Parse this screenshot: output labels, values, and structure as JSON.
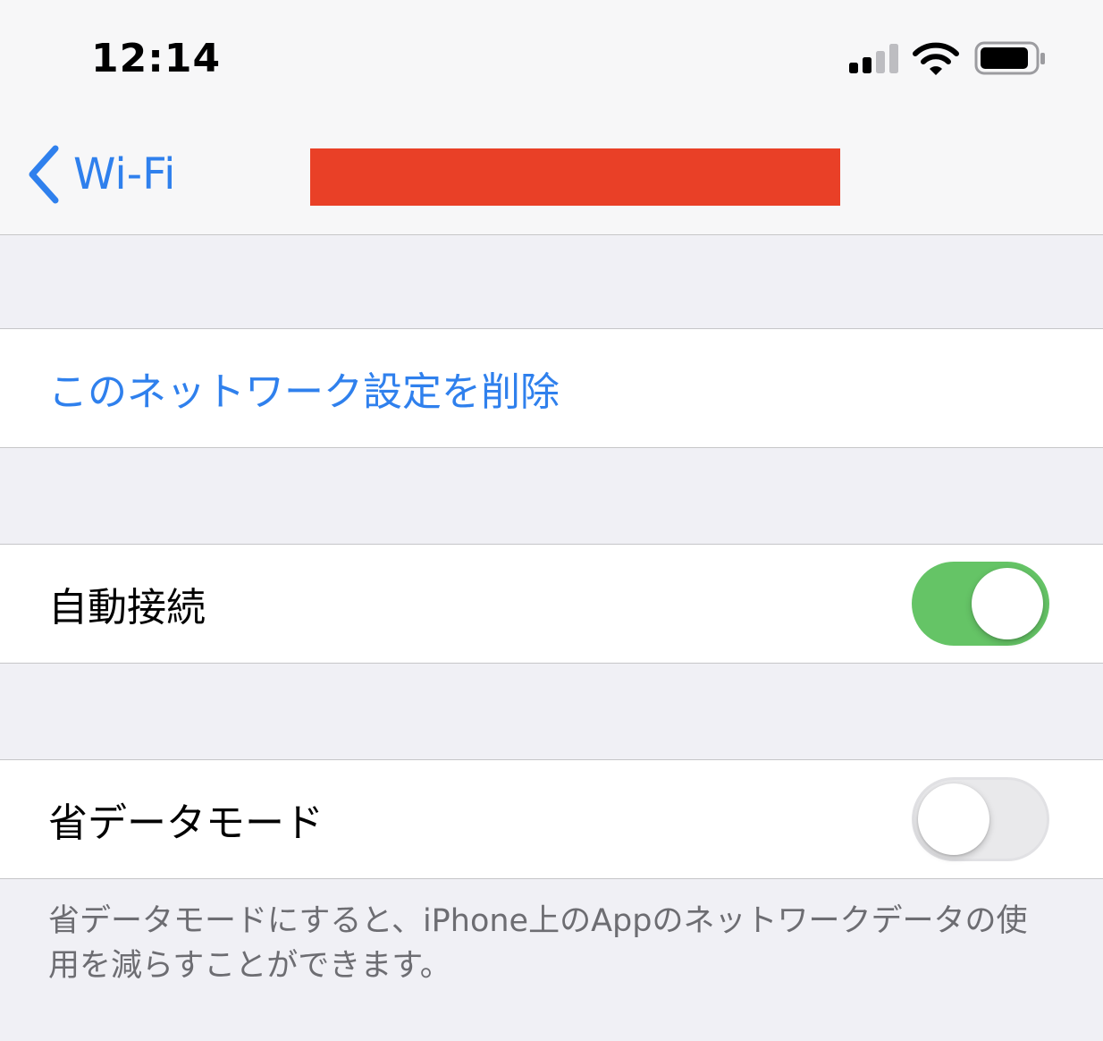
{
  "status_bar": {
    "time": "12:14",
    "signal_icon": "cellular-signal-icon",
    "wifi_icon": "wifi-icon",
    "battery_icon": "battery-icon"
  },
  "nav": {
    "back_icon": "chevron-left-icon",
    "back_label": "Wi-Fi",
    "title_redacted": true
  },
  "forget_network": {
    "label": "このネットワーク設定を削除"
  },
  "auto_join": {
    "label": "自動接続",
    "enabled": true
  },
  "low_data_mode": {
    "label": "省データモード",
    "enabled": false,
    "footer": "省データモードにすると、iPhone上のAppのネットワークデータの使用を減らすことができます。"
  },
  "colors": {
    "accent": "#2f80ed",
    "toggle_on": "#65c466",
    "redaction": "#e94027",
    "grouped_background": "#f0f0f5"
  }
}
